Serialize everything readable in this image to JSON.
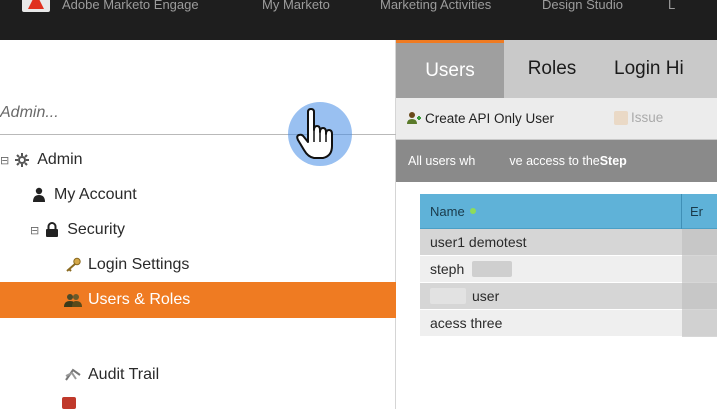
{
  "topnav": {
    "items": [
      {
        "label": "Adobe Marketo Engage"
      },
      {
        "label": "My Marketo"
      },
      {
        "label": "Marketing Activities"
      },
      {
        "label": "Design Studio"
      },
      {
        "label": "L"
      }
    ]
  },
  "sidebar": {
    "search_placeholder": "Admin...",
    "tree": [
      {
        "label": "Admin",
        "icon": "gear-icon",
        "expander": "⊟"
      },
      {
        "label": "My Account",
        "icon": "person-icon"
      },
      {
        "label": "Security",
        "icon": "lock-icon",
        "expander": "⊟"
      },
      {
        "label": "Login Settings",
        "icon": "key-icon"
      },
      {
        "label": "Users & Roles",
        "icon": "users-icon",
        "selected": true
      },
      {
        "label": "Audit Trail",
        "icon": "audit-icon"
      }
    ]
  },
  "tabs": [
    {
      "label": "Users",
      "active": true
    },
    {
      "label": "Roles"
    },
    {
      "label": "Login Hi"
    }
  ],
  "toolbar": {
    "create_api_user": "Create API Only User",
    "issue": "Issue"
  },
  "infobar": {
    "text": "All users wh",
    "text2": "ve access to the ",
    "bold": "Step"
  },
  "grid": {
    "columns": [
      "Name",
      "Er"
    ],
    "rows": [
      {
        "name": "user1 demotest"
      },
      {
        "name": "steph"
      },
      {
        "name": "user"
      },
      {
        "name": "acess three"
      }
    ]
  },
  "colors": {
    "accent": "#ef7b22",
    "grid_header": "#5fb2d8",
    "topbar": "#1e1e1e"
  }
}
